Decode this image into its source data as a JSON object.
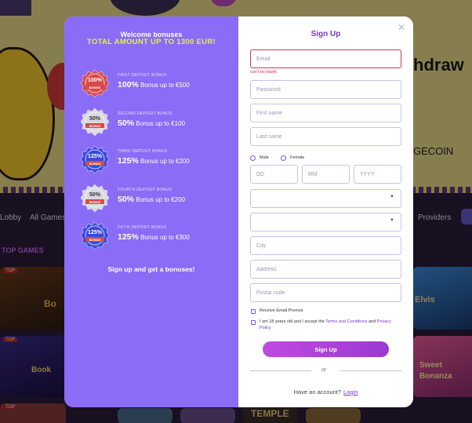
{
  "background": {
    "hero_text_1": "hdraw",
    "hero_text_2": "GECOIN",
    "nav": [
      "Lobby",
      "All Games",
      "Providers"
    ],
    "section_title": "TOP GAMES",
    "tile_tag": "TOP",
    "tiles_text": [
      "Bo",
      "Book",
      "Elvis",
      "Sweet",
      "Bonanza",
      "TEMPLE"
    ]
  },
  "promo": {
    "title": "Welcome bonuses",
    "total": "TOTAL AMOUNT UP TO 1300 EUR!",
    "bonuses": [
      {
        "badge": "100%",
        "badge_sub": "BONUS",
        "label": "first deposit bonus",
        "percent": "100%",
        "text": "Bonus up to €500",
        "color": "#d84a4a"
      },
      {
        "badge": "50%",
        "badge_sub": "BONUS",
        "label": "second deposit bonus",
        "percent": "50%",
        "text": "Bonus up to €100",
        "color": "#d8d8e0"
      },
      {
        "badge": "125%",
        "badge_sub": "BONUS",
        "label": "third deposit bonus",
        "percent": "125%",
        "text": "Bonus up to €200",
        "color": "#3a4ad8"
      },
      {
        "badge": "50%",
        "badge_sub": "BONUS",
        "label": "fourth deposit bonus",
        "percent": "50%",
        "text": "Bonus up to €200",
        "color": "#d8d8e0"
      },
      {
        "badge": "125%",
        "badge_sub": "BONUS",
        "label": "fifth deposit bonus",
        "percent": "125%",
        "text": "Bonus up to €300",
        "color": "#3a4ad8"
      }
    ],
    "footer": "Sign up and get a bonuses!"
  },
  "form": {
    "title": "Sign Up",
    "email_placeholder": "Email",
    "email_error": "can't be blank",
    "password_placeholder": "Password",
    "first_name_placeholder": "First name",
    "last_name_placeholder": "Last name",
    "gender_male": "Male",
    "gender_female": "Female",
    "dd_placeholder": "DD",
    "mm_placeholder": "MM",
    "yyyy_placeholder": "YYYY",
    "city_placeholder": "City",
    "address_placeholder": "Address",
    "postal_placeholder": "Postal code",
    "receive_promos": "Receive Email Promos",
    "age_prefix": "I am 18 years old and I accept the",
    "terms": "Terms and Conditions",
    "and": "and",
    "privacy": "Privacy Policy",
    "signup_button": "Sign Up",
    "or": "or",
    "have_account": "Have an account?",
    "login": "Login"
  }
}
